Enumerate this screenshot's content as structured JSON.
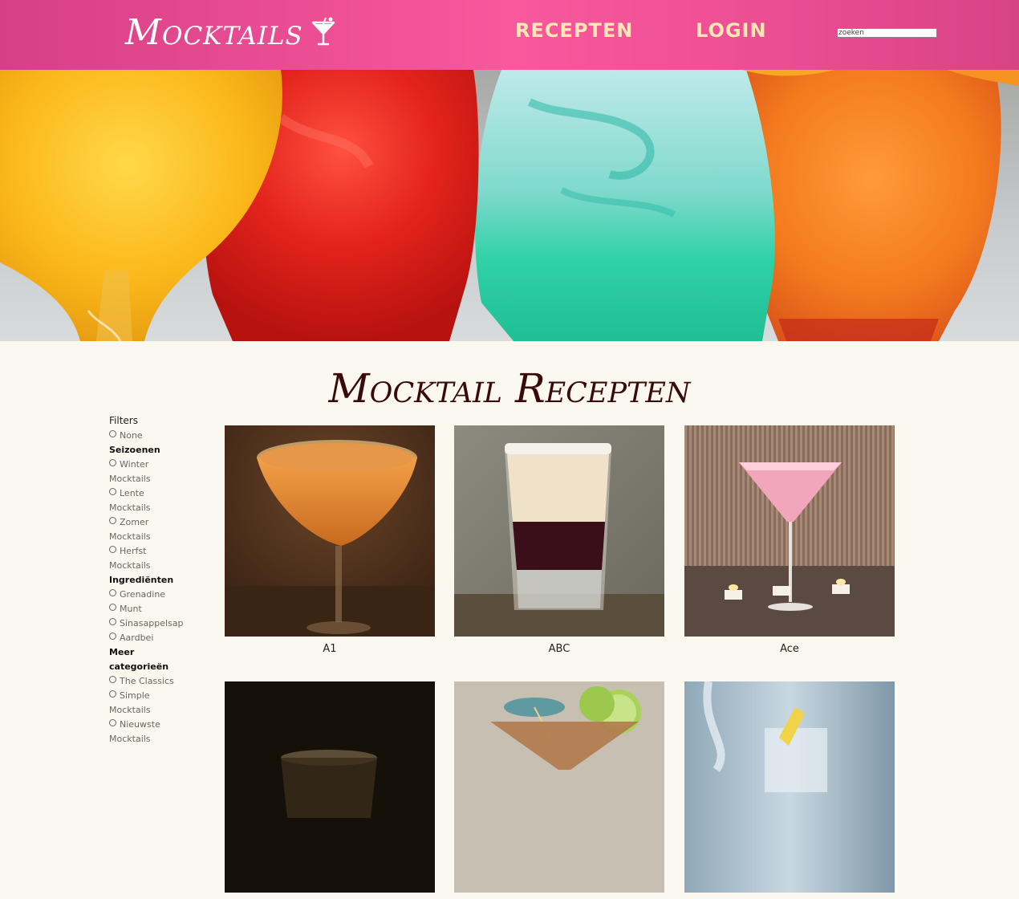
{
  "header": {
    "logo_text": "Mocktails",
    "nav": [
      "RECEPTEN",
      "LOGIN"
    ],
    "search_placeholder": "zoeken"
  },
  "page_title": "Mocktail Recepten",
  "filters": {
    "title": "Filters",
    "none_label": "None",
    "groups": [
      {
        "title": "Seizoenen",
        "options": [
          "Winter Mocktails",
          "Lente Mocktails",
          "Zomer Mocktails",
          "Herfst Mocktails"
        ]
      },
      {
        "title": "Ingrediënten",
        "options": [
          "Grenadine",
          "Munt",
          "Sinasappelsap",
          "Aardbei"
        ]
      },
      {
        "title": "Meer categorieën",
        "options": [
          "The Classics",
          "Simple Mocktails",
          "Nieuwste Mocktails"
        ]
      }
    ]
  },
  "recipes": [
    {
      "name": "A1"
    },
    {
      "name": "ABC"
    },
    {
      "name": "Ace"
    },
    {
      "name": ""
    },
    {
      "name": ""
    },
    {
      "name": ""
    }
  ],
  "colors": {
    "header_pink": "#ef5096",
    "nav_text": "#fde8b4",
    "background": "#fbf9ef",
    "title": "#3a0a0a"
  }
}
